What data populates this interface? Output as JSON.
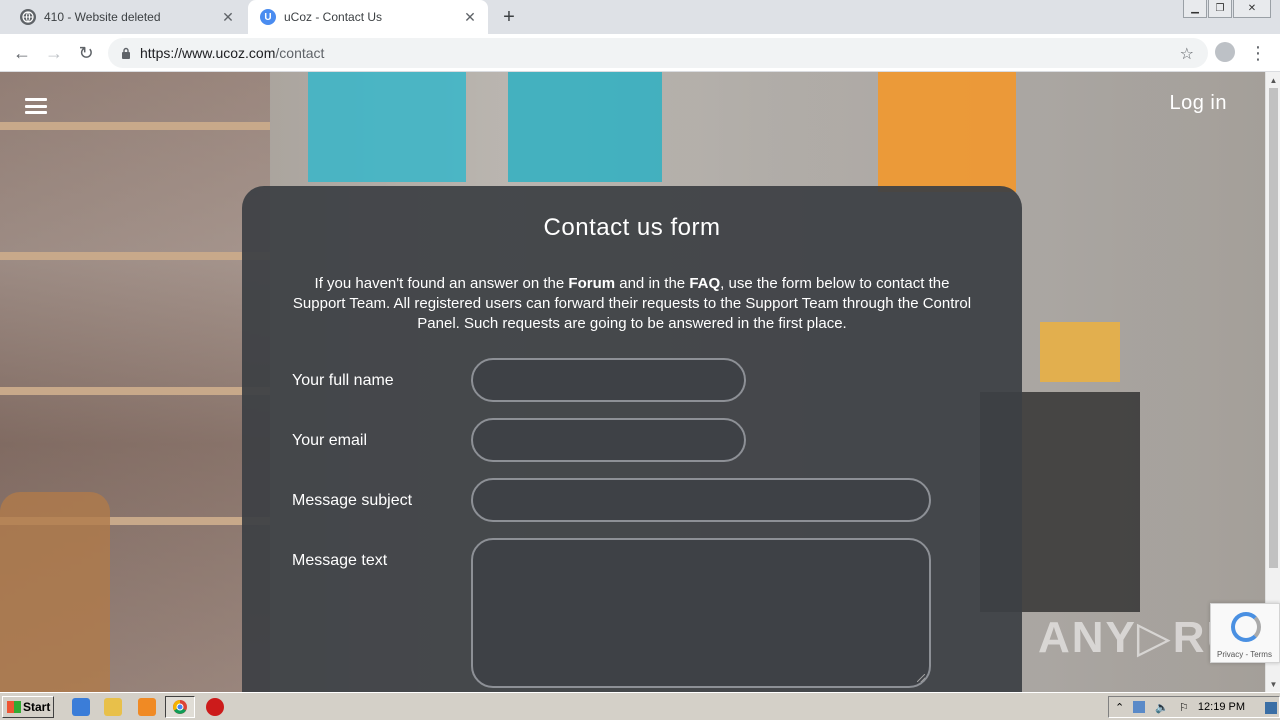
{
  "browser": {
    "tabs": [
      {
        "title": "410 - Website deleted",
        "active": false
      },
      {
        "title": "uCoz - Contact Us",
        "active": true
      }
    ],
    "active_favicon_letter": "U",
    "url_host": "https://www.ucoz.com",
    "url_path": "/contact"
  },
  "page": {
    "login_label": "Log in",
    "form_title": "Contact us form",
    "intro": {
      "part1": "If you haven't found an answer on the ",
      "forum": "Forum",
      "part2": " and in the ",
      "faq": "FAQ",
      "part3": ", use the form below to contact the Support Team. All registered users can forward their requests to the Support Team through the Control Panel. Such requests are going to be answered in the first place."
    },
    "fields": {
      "full_name_label": "Your full name",
      "email_label": "Your email",
      "subject_label": "Message subject",
      "message_label": "Message text"
    }
  },
  "overlay": {
    "watermark": "ANY▷RUN",
    "recaptcha_terms": "Privacy - Terms"
  },
  "taskbar": {
    "start_label": "Start",
    "clock": "12:19 PM"
  },
  "colors": {
    "card_bg": "#3c3f44",
    "chrome_tabstrip": "#dee1e6",
    "accent_favicon": "#4a8cf0"
  }
}
